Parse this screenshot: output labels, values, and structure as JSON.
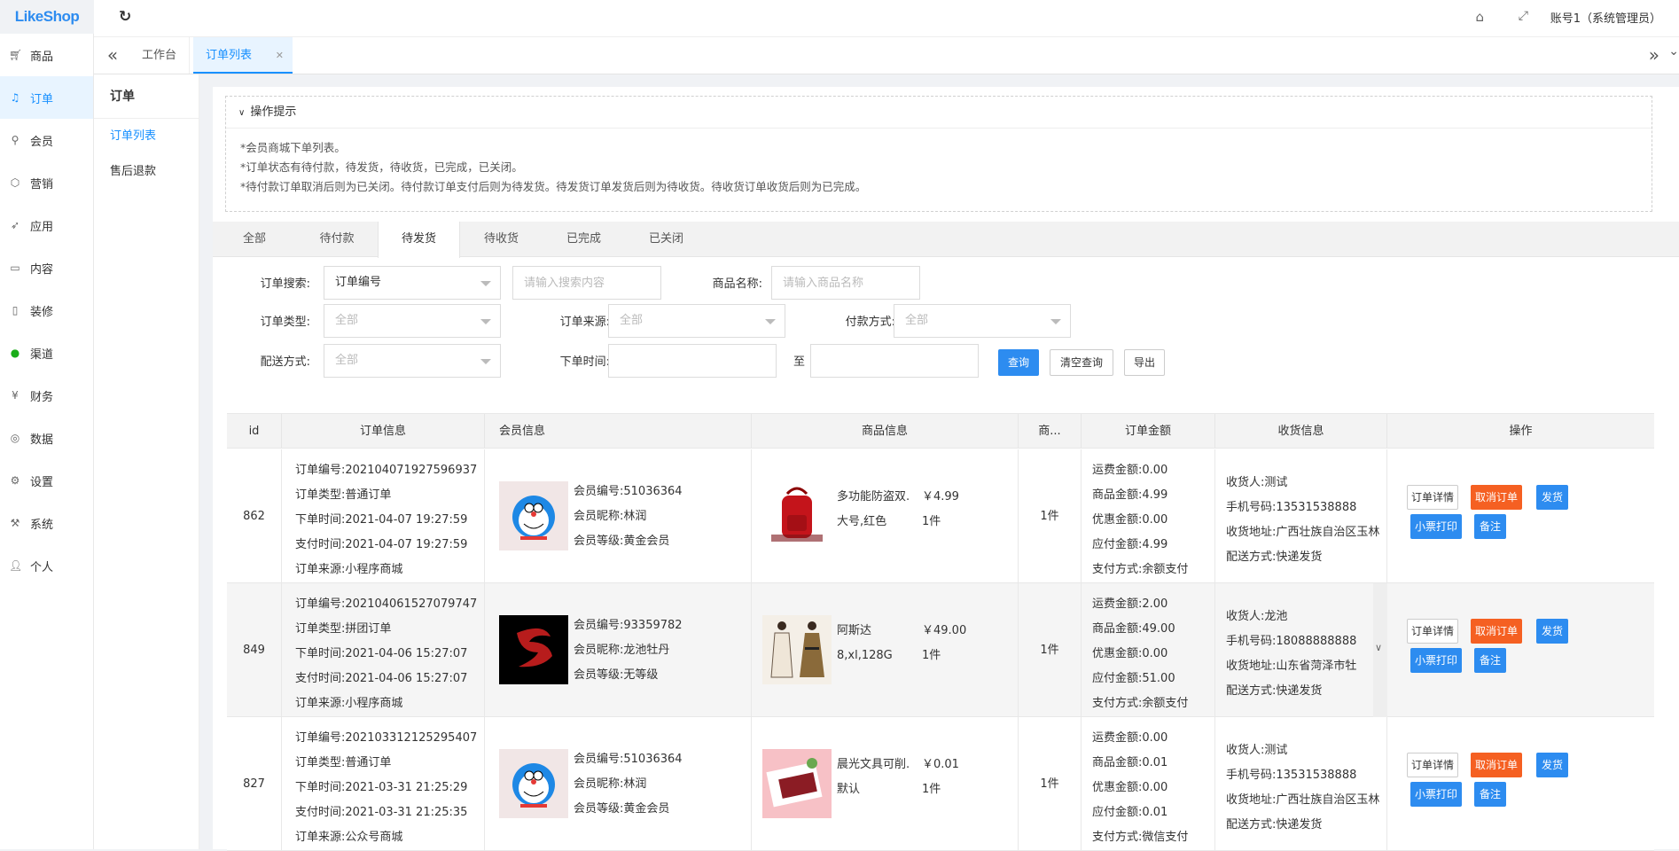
{
  "brand": {
    "logo_text": "LikeShop"
  },
  "topbar": {
    "account": "账号1（系统管理员）"
  },
  "sidebar": {
    "items": [
      {
        "label": "商品",
        "icon": "cart-icon"
      },
      {
        "label": "订单",
        "icon": "bell-icon",
        "active": true
      },
      {
        "label": "会员",
        "icon": "user-icon"
      },
      {
        "label": "营销",
        "icon": "box-icon"
      },
      {
        "label": "应用",
        "icon": "send-icon"
      },
      {
        "label": "内容",
        "icon": "book-icon"
      },
      {
        "label": "装修",
        "icon": "phone-icon"
      },
      {
        "label": "渠道",
        "icon": "wechat-icon"
      },
      {
        "label": "财务",
        "icon": "yen-icon"
      },
      {
        "label": "数据",
        "icon": "globe-icon"
      },
      {
        "label": "设置",
        "icon": "gear-icon"
      },
      {
        "label": "系统",
        "icon": "tools-icon"
      },
      {
        "label": "个人",
        "icon": "person-icon"
      }
    ]
  },
  "tabs": {
    "home": "工作台",
    "orders": "订单列表"
  },
  "subnav": {
    "title": "订单",
    "links": [
      "订单列表",
      "售后退款"
    ]
  },
  "tips": {
    "header": "操作提示",
    "lines": [
      "*会员商城下单列表。",
      "*订单状态有待付款，待发货，待收货，已完成，已关闭。",
      "*待付款订单取消后则为已关闭。待付款订单支付后则为待发货。待发货订单发货后则为待收货。待收货订单收货后则为已完成。"
    ]
  },
  "status_tabs": [
    "全部",
    "待付款",
    "待发货",
    "待收货",
    "已完成",
    "已关闭"
  ],
  "status_active": "待发货",
  "filters": {
    "search_label": "订单搜索:",
    "search_type": "订单编号",
    "search_placeholder": "请输入搜索内容",
    "goods_label": "商品名称:",
    "goods_placeholder": "请输入商品名称",
    "type_label": "订单类型:",
    "type_value": "全部",
    "source_label": "订单来源:",
    "source_value": "全部",
    "pay_label": "付款方式:",
    "pay_value": "全部",
    "delivery_label": "配送方式:",
    "delivery_value": "全部",
    "time_label": "下单时间:",
    "time_to": "至",
    "btn_query": "查询",
    "btn_clear": "清空查询",
    "btn_export": "导出"
  },
  "table": {
    "headers": [
      "id",
      "订单信息",
      "会员信息",
      "商品信息",
      "商...",
      "订单金额",
      "收货信息",
      "操作"
    ],
    "rows": [
      {
        "id": "862",
        "order": [
          "订单编号:202104071927596937",
          "订单类型:普通订单",
          "下单时间:2021-04-07 19:27:59",
          "支付时间:2021-04-07 19:27:59",
          "订单来源:小程序商城"
        ],
        "member": [
          "会员编号:51036364",
          "会员昵称:林润",
          "会员等级:黄金会员"
        ],
        "avatar": "doraemon",
        "goods_name": [
          "多功能防盗双...",
          "大号,红色"
        ],
        "goods_price": [
          "￥4.99",
          "1件"
        ],
        "goods_img": "red-backpack",
        "qty": "1件",
        "amount": [
          "运费金额:0.00",
          "商品金额:4.99",
          "优惠金额:0.00",
          "应付金额:4.99",
          "支付方式:余额支付"
        ],
        "receiver": [
          "收货人:测试",
          "手机号码:13531538888",
          "收货地址:广西壮族自治区玉林",
          "配送方式:快递发货"
        ]
      },
      {
        "id": "849",
        "order": [
          "订单编号:202104061527079747",
          "订单类型:拼团订单",
          "下单时间:2021-04-06 15:27:07",
          "支付时间:2021-04-06 15:27:07",
          "订单来源:小程序商城"
        ],
        "member": [
          "会员编号:93359782",
          "会员昵称:龙池牡丹",
          "会员等级:无等级"
        ],
        "avatar": "dragon",
        "goods_name": [
          "阿斯达",
          "8,xl,128G"
        ],
        "goods_price": [
          "￥49.00",
          "1件"
        ],
        "goods_img": "dress",
        "qty": "1件",
        "amount": [
          "运费金额:2.00",
          "商品金额:49.00",
          "优惠金额:0.00",
          "应付金额:51.00",
          "支付方式:余额支付"
        ],
        "receiver": [
          "收货人:龙池",
          "手机号码:18088888888",
          "收货地址:山东省菏泽市牡",
          "配送方式:快递发货"
        ]
      },
      {
        "id": "827",
        "order": [
          "订单编号:202103312125295407",
          "订单类型:普通订单",
          "下单时间:2021-03-31 21:25:29",
          "支付时间:2021-03-31 21:25:35",
          "订单来源:公众号商城"
        ],
        "member": [
          "会员编号:51036364",
          "会员昵称:林润",
          "会员等级:黄金会员"
        ],
        "avatar": "doraemon",
        "goods_name": [
          "晨光文具可削...",
          "默认"
        ],
        "goods_price": [
          "￥0.01",
          "1件"
        ],
        "goods_img": "stationery",
        "qty": "1件",
        "amount": [
          "运费金额:0.00",
          "商品金额:0.01",
          "优惠金额:0.00",
          "应付金额:0.01",
          "支付方式:微信支付"
        ],
        "receiver": [
          "收货人:测试",
          "手机号码:13531538888",
          "收货地址:广西壮族自治区玉林",
          "配送方式:快递发货"
        ]
      }
    ],
    "actions": {
      "detail": "订单详情",
      "cancel": "取消订单",
      "ship": "发货",
      "print": "小票打印",
      "note": "备注"
    }
  },
  "colors": {
    "primary": "#2d8cf0",
    "danger": "#f56022",
    "active_bg": "#e8f4ff"
  }
}
